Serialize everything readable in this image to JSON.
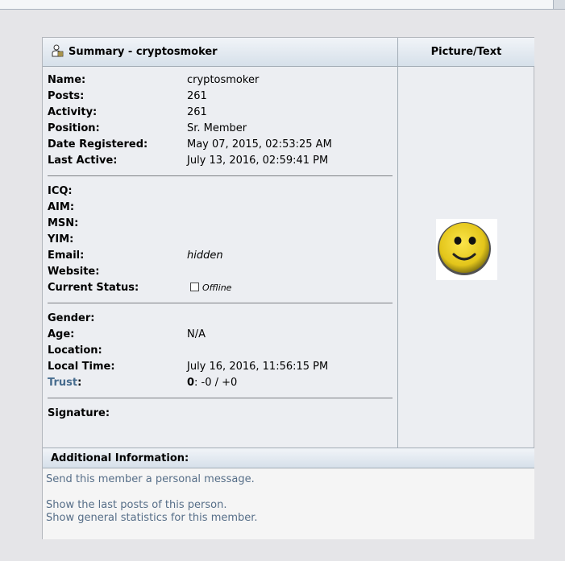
{
  "header": {
    "summary_title": "Summary - cryptosmoker",
    "picture_title": "Picture/Text"
  },
  "summary": {
    "name": {
      "label": "Name:",
      "value": "cryptosmoker"
    },
    "posts": {
      "label": "Posts:",
      "value": "261"
    },
    "activity": {
      "label": "Activity:",
      "value": "261"
    },
    "position": {
      "label": "Position:",
      "value": "Sr. Member"
    },
    "date_registered": {
      "label": "Date Registered:",
      "value": "May 07, 2015, 02:53:25 AM"
    },
    "last_active": {
      "label": "Last Active:",
      "value": "July 13, 2016, 02:59:41 PM"
    }
  },
  "contact": {
    "icq": {
      "label": "ICQ:",
      "value": ""
    },
    "aim": {
      "label": "AIM:",
      "value": ""
    },
    "msn": {
      "label": "MSN:",
      "value": ""
    },
    "yim": {
      "label": "YIM:",
      "value": ""
    },
    "email": {
      "label": "Email:",
      "value": "hidden"
    },
    "website": {
      "label": "Website:",
      "value": ""
    },
    "current_status": {
      "label": "Current Status:",
      "value": "Offline"
    }
  },
  "personal": {
    "gender": {
      "label": "Gender:",
      "value": ""
    },
    "age": {
      "label": "Age:",
      "value": "N/A"
    },
    "location": {
      "label": "Location:",
      "value": ""
    },
    "local_time": {
      "label": "Local Time:",
      "value": "July 16, 2016, 11:56:15 PM"
    },
    "trust": {
      "label": "Trust",
      "colon": ":",
      "score": "0",
      "value": ": -0 / +0"
    }
  },
  "signature": {
    "label": "Signature:"
  },
  "additional": {
    "title": "Additional Information:",
    "links": [
      "Send this member a personal message.",
      "Show the last posts of this person.",
      "Show general statistics for this member."
    ]
  },
  "icons": {
    "header_icon": "user-icon",
    "avatar": "smiley-avatar-icon",
    "status": "status-checkbox-icon"
  },
  "colors": {
    "link": "#566e88",
    "trust_link": "#476c8e",
    "header_gradient_top": "#f1f4f8",
    "header_gradient_bottom": "#d6e0ea"
  }
}
